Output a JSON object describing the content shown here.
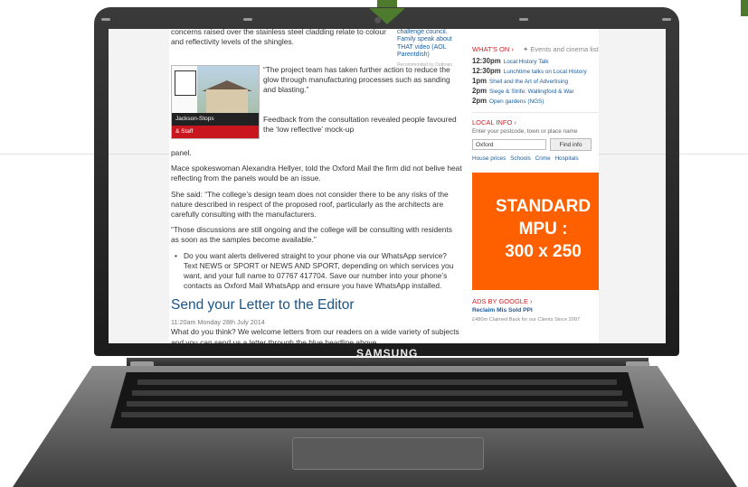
{
  "brand": "SAMSUNG",
  "article": {
    "top_line": "concerns raised over the stainless steel cladding relate to colour and reflectivity levels of the shingles.",
    "image_tag_line1": "Jackson-Stops",
    "image_tag_line2": "& Staff",
    "quote1": "“The project team has taken further action to reduce the glow through manufacturing processes such as sanding and blasting.”",
    "quote2": "Feedback from the consultation revealed people favoured the ‘low reflective’ mock-up",
    "panel_word": "panel.",
    "para2": "Mace spokeswoman Alexandra Hellyer, told the Oxford Mail the firm did not belive heat reflecting from the panels would be an issue.",
    "para3": "She said: “The college’s design team does not consider there to be any risks of the nature described in respect of the proposed roof, particularly as the architects are carefully consulting with the manufacturers.",
    "para4": "“Those discussions are still ongoing and the college will be consulting with residents as soon as the samples become available.”",
    "bullet": "Do you want alerts delivered straight to your phone via our WhatsApp service? Text NEWS or SPORT or NEWS AND SPORT, depending on which services you want, and your full name to 07767 417704. Save our number into your phone’s contacts as Oxford Mail WhatsApp and ensure you have WhatsApp installed.",
    "letter_heading": "Send your Letter to the Editor",
    "timestamp": "11:20am Monday 28th July 2014",
    "letter_line": "What do you think? We welcome letters from our readers on a wide variety of subjects and you can send us a letter through the blue headline above."
  },
  "aside_top": {
    "lines": "challenge council. Family speak about THAT video (AOL Parentdish)",
    "outbrain": "Recommended by Outbrain"
  },
  "sidebar": {
    "whats_on": "WHAT'S ON",
    "events_link": "Events and cinema listings",
    "events": [
      {
        "time": "12:30pm",
        "name": "Local History Talk"
      },
      {
        "time": "12:30pm",
        "name": "Lunchtime talks on Local History"
      },
      {
        "time": "1pm",
        "name": "Shell and the Art of Advertising"
      },
      {
        "time": "2pm",
        "name": "Siege & Strife: Wallingford & War"
      },
      {
        "time": "2pm",
        "name": "Open gardens (NGS)"
      }
    ],
    "local_info": "LOCAL INFO",
    "local_prompt": "Enter your postcode, town or place name",
    "local_input_value": "Oxford",
    "find_button": "Find info",
    "links": [
      "House prices",
      "Schools",
      "Crime",
      "Hospitals"
    ],
    "mpu_line1": "STANDARD",
    "mpu_line2": "MPU :",
    "mpu_line3": "300 x 250",
    "ads_head": "ADS BY GOOGLE",
    "ads_link": "Reclaim Mis Sold PPI",
    "ads_sub": "£480m Claimed Back for our Clients Since 2007"
  }
}
